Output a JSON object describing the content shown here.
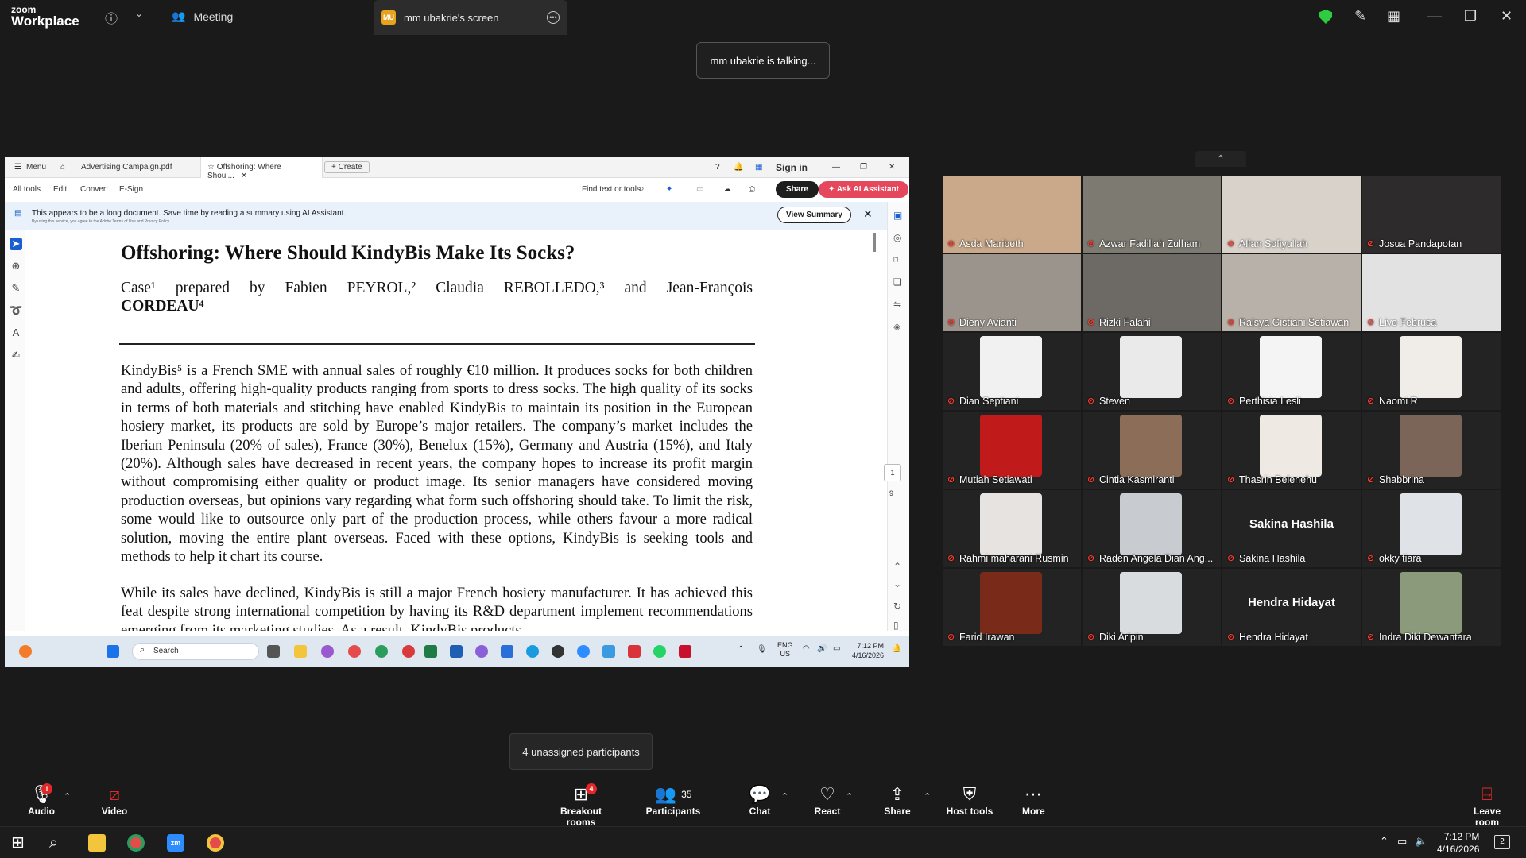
{
  "zoom": {
    "logo_top": "zoom",
    "logo_bottom": "Workplace",
    "meeting_tab": "Meeting",
    "share_badge": "MU",
    "share_tab": "mm ubakrie's screen",
    "talking": "mm ubakrie is talking..."
  },
  "acrobat": {
    "menu": "Menu",
    "tab1": "Advertising Campaign.pdf",
    "tab2": "Offshoring: Where Shoul...",
    "create": "Create",
    "sign_in": "Sign in",
    "tools": [
      "All tools",
      "Edit",
      "Convert",
      "E-Sign"
    ],
    "find": "Find text or tools",
    "share": "Share",
    "ai": "Ask AI Assistant",
    "banner_text": "This appears to be a long document. Save time by reading a summary using AI Assistant.",
    "banner_small": "By using this service, you agree to the Adobe Terms of Use and Privacy Policy.",
    "view_summary": "View Summary",
    "page_current": "1",
    "page_total": "9"
  },
  "document": {
    "title": "Offshoring: Where Should KindyBis Make Its Socks?",
    "author_line1": "Case¹ prepared by Fabien PEYROL,² Claudia REBOLLEDO,³ and Jean-François",
    "author_line2": "CORDEAU⁴",
    "para1": "KindyBis⁵ is a French SME with annual sales of roughly €10 million. It produces socks for both children and adults, offering high-quality products ranging from sports to dress socks. The high quality of its socks in terms of both materials and stitching have enabled KindyBis to maintain its position in the European hosiery market, its products are sold by Europe’s major retailers. The company’s market includes the Iberian Peninsula (20% of sales), France (30%), Benelux (15%), Germany and Austria (15%), and Italy (20%). Although sales have decreased in recent years, the company hopes to increase its profit margin without compromising either quality or product image. Its senior managers have considered moving production overseas, but opinions vary regarding what form such offshoring should take. To limit the risk, some would like to outsource only part of the production process, while others favour a more radical solution, moving the entire plant overseas. Faced with these options, KindyBis is seeking tools and methods to help it chart its course.",
    "para2": "While its sales have declined, KindyBis is still a major French hosiery manufacturer. It has achieved this feat despite strong international competition by having its R&D department implement recommendations emerging from its marketing studies. As a result, KindyBis products"
  },
  "remote_taskbar": {
    "search": "Search",
    "lang1": "ENG",
    "lang2": "US",
    "time": "7:12 PM",
    "date": "4/16/2026"
  },
  "participants": [
    {
      "name": "Asda Maribeth",
      "color": "#c9a98a"
    },
    {
      "name": "Azwar Fadillah Zulham",
      "color": "#7d7a72"
    },
    {
      "name": "Alfan Sofiyullah",
      "color": "#d8d2cb"
    },
    {
      "name": "Josua Pandapotan",
      "color": "#2e2b2c"
    },
    {
      "name": "Dieny Avianti",
      "color": "#9a948d"
    },
    {
      "name": "Rizki Falahi",
      "color": "#6d6a66"
    },
    {
      "name": "Raisya Gistiani Setiawan",
      "color": "#b8b1a9"
    },
    {
      "name": "Livo Februsa",
      "color": "#e2e2e2"
    },
    {
      "name": "Dian Septiani",
      "color": "#f1f1f1"
    },
    {
      "name": "Steven",
      "color": "#eaeaea"
    },
    {
      "name": "Perthisia Lesli",
      "color": "#f4f4f4"
    },
    {
      "name": "Naomi R",
      "color": "#f0ece8"
    },
    {
      "name": "Mutiah Setiawati",
      "color": "#c01a1a"
    },
    {
      "name": "Cintia Kasmiranti",
      "color": "#8b6d58"
    },
    {
      "name": "Thasrin Belenehu",
      "color": "#eee9e2"
    },
    {
      "name": "Shabbrina",
      "color": "#7b6558"
    },
    {
      "name": "Rahmi maharani Rusmin",
      "color": "#e6e3e0"
    },
    {
      "name": "Raden Angela Dian Ang...",
      "color": "#c8cbd0"
    },
    {
      "name": "Sakina Hashila",
      "big": "Sakina Hashila"
    },
    {
      "name": "okky tiara",
      "color": "#dfe2e6"
    },
    {
      "name": "Farid Irawan",
      "color": "#7a2a18"
    },
    {
      "name": "Diki Aripin",
      "color": "#d9dcdf"
    },
    {
      "name": "Hendra Hidayat",
      "big": "Hendra Hidayat"
    },
    {
      "name": "Indra Diki Dewantara",
      "color": "#8a9a7a"
    }
  ],
  "unassigned": "4 unassigned participants",
  "toolbar": {
    "audio": "Audio",
    "audio_badge": "!",
    "video": "Video",
    "breakout": "Breakout rooms",
    "breakout_badge": "4",
    "participants": "Participants",
    "participants_count": "35",
    "chat": "Chat",
    "react": "React",
    "share": "Share",
    "host_tools": "Host tools",
    "more": "More",
    "leave": "Leave room"
  },
  "taskbar": {
    "time": "7:12 PM",
    "date": "4/16/2026",
    "notif": "2"
  }
}
